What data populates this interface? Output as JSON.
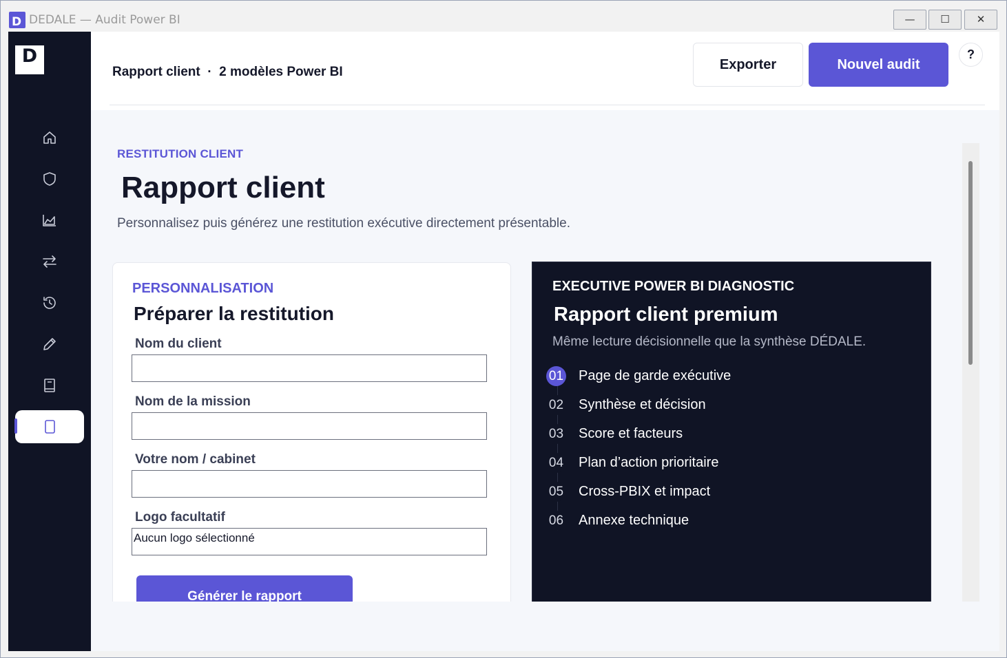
{
  "window": {
    "title": "DEDALE — Audit Power BI",
    "controls": {
      "minimize": "—",
      "maximize": "☐",
      "close": "✕"
    }
  },
  "sidebar": {
    "logo": "D",
    "items": [
      {
        "name": "home",
        "icon": "home-icon",
        "active": false
      },
      {
        "name": "audit",
        "icon": "shield-icon",
        "active": false
      },
      {
        "name": "analytics",
        "icon": "area-chart-icon",
        "active": false
      },
      {
        "name": "compare",
        "icon": "swap-arrows-icon",
        "active": false
      },
      {
        "name": "history",
        "icon": "history-icon",
        "active": false
      },
      {
        "name": "edit",
        "icon": "pencil-icon",
        "active": false
      },
      {
        "name": "documentation",
        "icon": "book-icon",
        "active": false
      },
      {
        "name": "report",
        "icon": "document-icon",
        "active": true
      }
    ]
  },
  "header": {
    "breadcrumb": "Rapport client  ·  2 modèles Power BI",
    "export_label": "Exporter",
    "new_audit_label": "Nouvel audit",
    "help_label": "?"
  },
  "page": {
    "eyebrow": "RESTITUTION CLIENT",
    "title": "Rapport client",
    "subtitle": "Personnalisez puis générez une restitution exécutive directement présentable."
  },
  "form": {
    "eyebrow": "PERSONNALISATION",
    "title": "Préparer la restitution",
    "fields": {
      "client_name": {
        "label": "Nom du client",
        "value": ""
      },
      "mission_name": {
        "label": "Nom de la mission",
        "value": ""
      },
      "author_name": {
        "label": "Votre nom / cabinet",
        "value": ""
      },
      "logo": {
        "label": "Logo facultatif",
        "value": "Aucun logo sélectionné"
      }
    },
    "generate_label": "Générer le rapport"
  },
  "preview": {
    "eyebrow": "EXECUTIVE POWER BI DIAGNOSTIC",
    "title": "Rapport client premium",
    "subtitle": "Même lecture décisionnelle que la synthèse DÉDALE.",
    "sections": [
      {
        "num": "01",
        "label": "Page de garde exécutive",
        "active": true
      },
      {
        "num": "02",
        "label": "Synthèse et décision",
        "active": false
      },
      {
        "num": "03",
        "label": "Score et facteurs",
        "active": false
      },
      {
        "num": "04",
        "label": "Plan d’action prioritaire",
        "active": false
      },
      {
        "num": "05",
        "label": "Cross-PBIX et impact",
        "active": false
      },
      {
        "num": "06",
        "label": "Annexe technique",
        "active": false
      }
    ]
  },
  "colors": {
    "accent": "#5b56d6",
    "sidebar": "#101425",
    "background": "#f5f7fb"
  }
}
